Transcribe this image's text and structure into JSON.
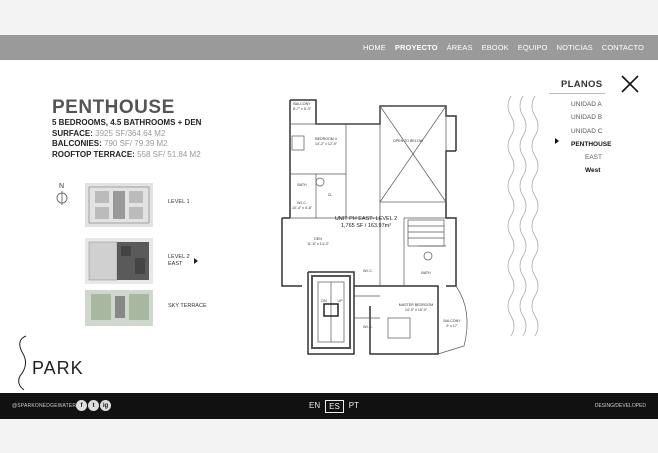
{
  "nav": {
    "items": [
      "HOME",
      "PROYECTO",
      "ÁREAS",
      "EBOOK",
      "EQUIPO",
      "NOTICIAS",
      "CONTACTO"
    ],
    "active": "PROYECTO"
  },
  "unit": {
    "title": "PENTHOUSE",
    "rooms": "5 BEDROOMS, 4.5 BATHROOMS + DEN",
    "surface_label": "SURFACE:",
    "surface_value": "3925 SF/364.64 M2",
    "balconies_label": "BALCONIES:",
    "balconies_value": "790 SF/ 79.39 M2",
    "terrace_label": "ROOFTOP TERRACE:",
    "terrace_value": "558 SF/ 51.84 M2"
  },
  "compass": {
    "label": "N"
  },
  "levels": [
    {
      "line1": "LEVEL 1",
      "line2": ""
    },
    {
      "line1": "LEVEL 2",
      "line2": "EAST"
    },
    {
      "line1": "SKY TERRACE",
      "line2": ""
    }
  ],
  "planos": {
    "heading": "PLANOS",
    "units": [
      "UNIDAD A",
      "UNIDAD B",
      "UNIDAD C",
      "PENTHOUSE",
      "EAST",
      "West"
    ],
    "selected": "PENTHOUSE"
  },
  "floorplan": {
    "labels": {
      "balcony_top": "BALCONY",
      "balcony_top_dim": "8'-7\" x 5'-0\"",
      "bedroom4": "BEDROOM 4",
      "bedroom4_dim": "14'-2\" x 12'-9\"",
      "open_below": "OPEN TO BELOW",
      "bath": "BATH",
      "wic": "W.I.C.",
      "wic_dim": "10'-4\" x 4'-8\"",
      "cl": "CL",
      "unit_name": "UNIT PH EAST- LEVEL 2",
      "unit_area": "1,765 SF / 163.97m²",
      "den": "DEN",
      "den_dim": "11'-8\" x 14'-3\"",
      "wic2": "W.I.C.",
      "wic3": "W.I.C.",
      "master": "MASTER BEDROOM",
      "master_dim": "14'-0\" x 15'-0\"",
      "balcony_right": "BALCONY",
      "balcony_right_dim": "9' x 17'",
      "bath2": "BATH",
      "dn": "DN",
      "up": "UP"
    }
  },
  "footer": {
    "handle": "@SPARKONEDGEWATER",
    "social": [
      "f",
      "t",
      "ig"
    ],
    "langs": [
      "EN",
      "ES",
      "PT"
    ],
    "active_lang": "ES",
    "credit": "DESING/DEVELOPED"
  },
  "logo": {
    "text": "PARK"
  }
}
